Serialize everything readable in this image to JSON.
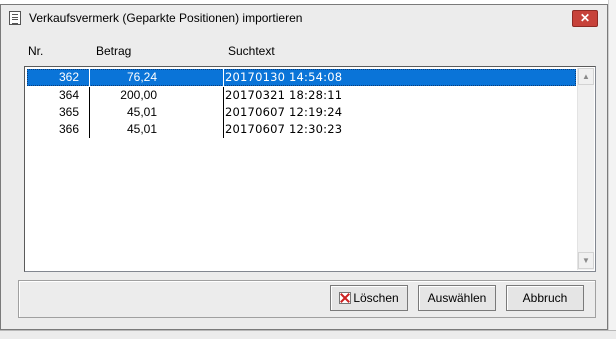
{
  "window": {
    "title": "Verkaufsvermerk (Geparkte Positionen) importieren",
    "close_glyph": "✕"
  },
  "list": {
    "columns": [
      "Nr.",
      "Betrag",
      "Suchtext"
    ],
    "rows": [
      {
        "nr": "362",
        "betrag": "76,24",
        "suchtext": "20170130 14:54:08",
        "selected": true
      },
      {
        "nr": "364",
        "betrag": "200,00",
        "suchtext": "20170321 18:28:11",
        "selected": false
      },
      {
        "nr": "365",
        "betrag": "45,01",
        "suchtext": "20170607 12:19:24",
        "selected": false
      },
      {
        "nr": "366",
        "betrag": "45,01",
        "suchtext": "20170607 12:30:23",
        "selected": false
      }
    ]
  },
  "scrollbar": {
    "up_glyph": "▲",
    "down_glyph": "▼"
  },
  "buttons": {
    "delete_label": "Löschen",
    "select_label": "Auswählen",
    "cancel_label": "Abbruch"
  },
  "icons": {
    "title": "app-window-icon",
    "delete": "delete-icon"
  },
  "colors": {
    "selection": "#0a74d8",
    "close": "#c7423a",
    "dialog_bg": "#ececec"
  }
}
